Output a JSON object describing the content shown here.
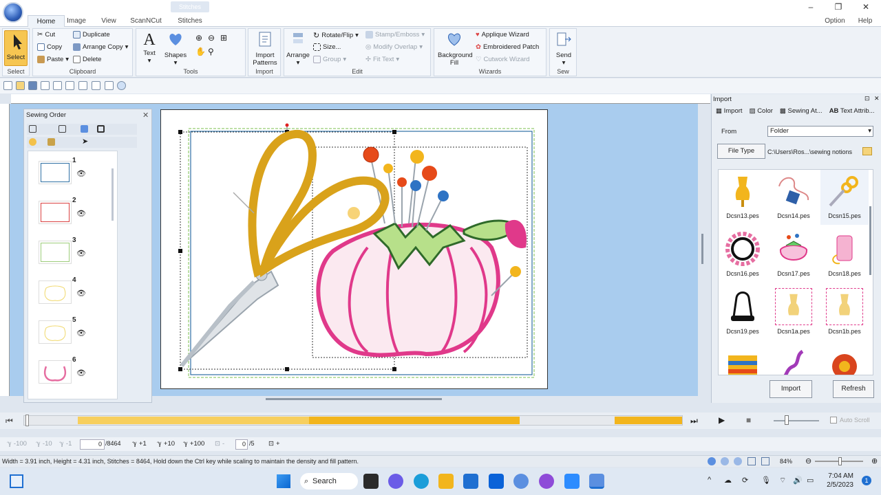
{
  "window": {
    "context_tab": "Stitches",
    "min": "–",
    "max": "❐",
    "close": "✕"
  },
  "tabs": [
    "Home",
    "Image",
    "View",
    "ScanNCut",
    "Stitches"
  ],
  "menu_right": {
    "option": "Option",
    "help": "Help"
  },
  "ribbon": {
    "select": {
      "label": "Select",
      "group": "Select"
    },
    "clipboard": {
      "cut": "Cut",
      "copy": "Copy",
      "paste": "Paste",
      "duplicate": "Duplicate",
      "arrange_copy": "Arrange Copy",
      "delete": "Delete",
      "group": "Clipboard"
    },
    "tools": {
      "text": "Text",
      "shapes": "Shapes",
      "group": "Tools"
    },
    "import": {
      "patterns": "Import Patterns",
      "group": "Import"
    },
    "edit": {
      "arrange": "Arrange",
      "rotate": "Rotate/Flip",
      "size": "Size...",
      "group_btn": "Group",
      "stamp": "Stamp/Emboss",
      "modify": "Modify Overlap",
      "fit_text": "Fit Text",
      "group": "Edit"
    },
    "wizards": {
      "bg_fill": "Background Fill",
      "applique": "Applique Wizard",
      "embroidered_patch": "Embroidered Patch",
      "cutwork": "Cutwork Wizard",
      "group": "Wizards"
    },
    "sew": {
      "send": "Send",
      "group": "Sew"
    }
  },
  "sewing_order": {
    "title": "Sewing Order",
    "items": [
      {
        "num": "1",
        "color": "#2e6fa3"
      },
      {
        "num": "2",
        "color": "#d94040"
      },
      {
        "num": "3",
        "color": "#9ccc7a"
      },
      {
        "num": "4",
        "color": "#f0d86a"
      },
      {
        "num": "5",
        "color": "#f0d86a"
      },
      {
        "num": "6",
        "color": "#e66ea1"
      }
    ]
  },
  "import_panel": {
    "title": "Import",
    "tabs": [
      "Import",
      "Color",
      "Sewing At...",
      "Text Attrib..."
    ],
    "from_label": "From",
    "from_value": "Folder",
    "file_type_btn": "File Type",
    "path": "C:\\Users\\Ros...\\sewing notions",
    "files": [
      {
        "name": "Dcsn13.pes",
        "icon": "dress-form"
      },
      {
        "name": "Dcsn14.pes",
        "icon": "thread-spool"
      },
      {
        "name": "Dcsn15.pes",
        "icon": "scissors"
      },
      {
        "name": "Dcsn16.pes",
        "icon": "button-ring"
      },
      {
        "name": "Dcsn17.pes",
        "icon": "pincushion"
      },
      {
        "name": "Dcsn18.pes",
        "icon": "spool"
      },
      {
        "name": "Dcsn19.pes",
        "icon": "thimble"
      },
      {
        "name": "Dcsn1a.pes",
        "icon": "dress-form-frame"
      },
      {
        "name": "Dcsn1b.pes",
        "icon": "dress-form-frame"
      },
      {
        "name": "",
        "icon": "fabric-stack"
      },
      {
        "name": "",
        "icon": "ribbon"
      },
      {
        "name": "",
        "icon": "pin-cushion-red"
      }
    ],
    "import_btn": "Import",
    "refresh_btn": "Refresh"
  },
  "playback": {
    "auto_scroll": "Auto Scroll"
  },
  "stitch_nav": {
    "b1": "-100",
    "b2": "-10",
    "b3": "-1",
    "stitch_value": "0",
    "stitch_total": "/8464",
    "f1": "+1",
    "f2": "+10",
    "f3": "+100",
    "color_value": "0",
    "color_total": "/5"
  },
  "status": {
    "text": "Width = 3.91 inch, Height = 4.31 inch, Stitches = 8464, Hold down the Ctrl key while scaling to maintain the density and fill pattern.",
    "zoom": "84%"
  },
  "taskbar": {
    "search": "Search",
    "time": "7:04 AM",
    "date": "2/5/2023",
    "badge": "1"
  }
}
